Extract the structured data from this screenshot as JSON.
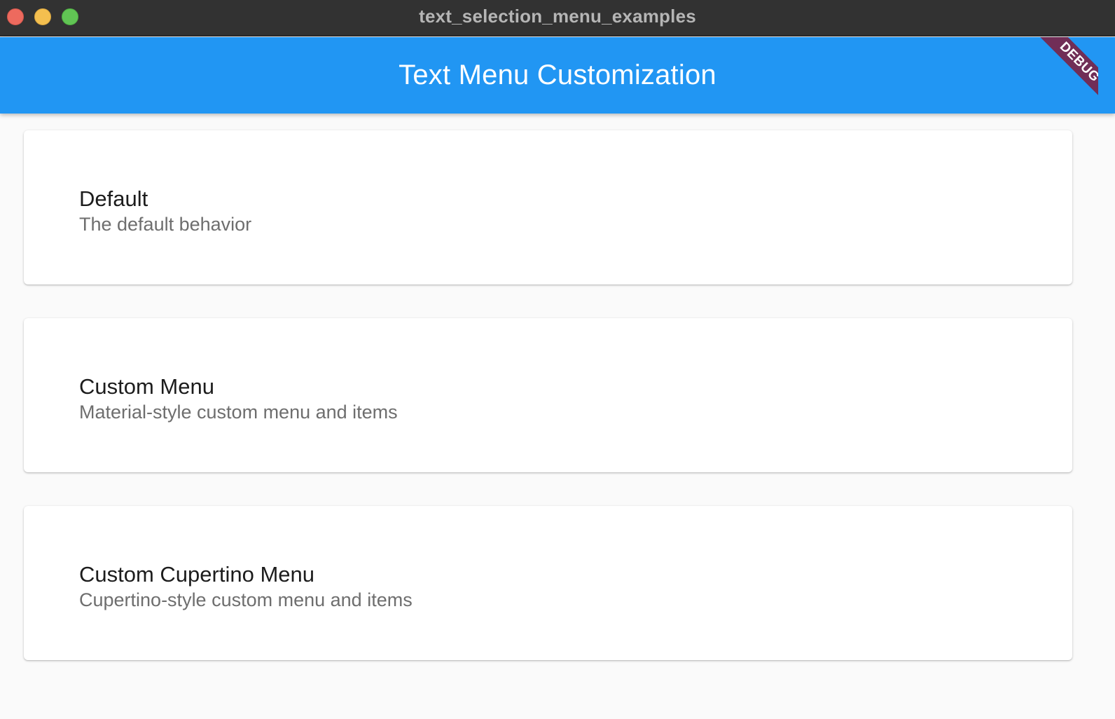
{
  "window": {
    "title": "text_selection_menu_examples"
  },
  "appbar": {
    "title": "Text Menu Customization",
    "background_color": "#2196f3"
  },
  "debug_banner": {
    "label": "DEBUG"
  },
  "examples": [
    {
      "title": "Default",
      "subtitle": "The default behavior"
    },
    {
      "title": "Custom Menu",
      "subtitle": "Material-style custom menu and items"
    },
    {
      "title": "Custom Cupertino Menu",
      "subtitle": "Cupertino-style custom menu and items"
    }
  ]
}
